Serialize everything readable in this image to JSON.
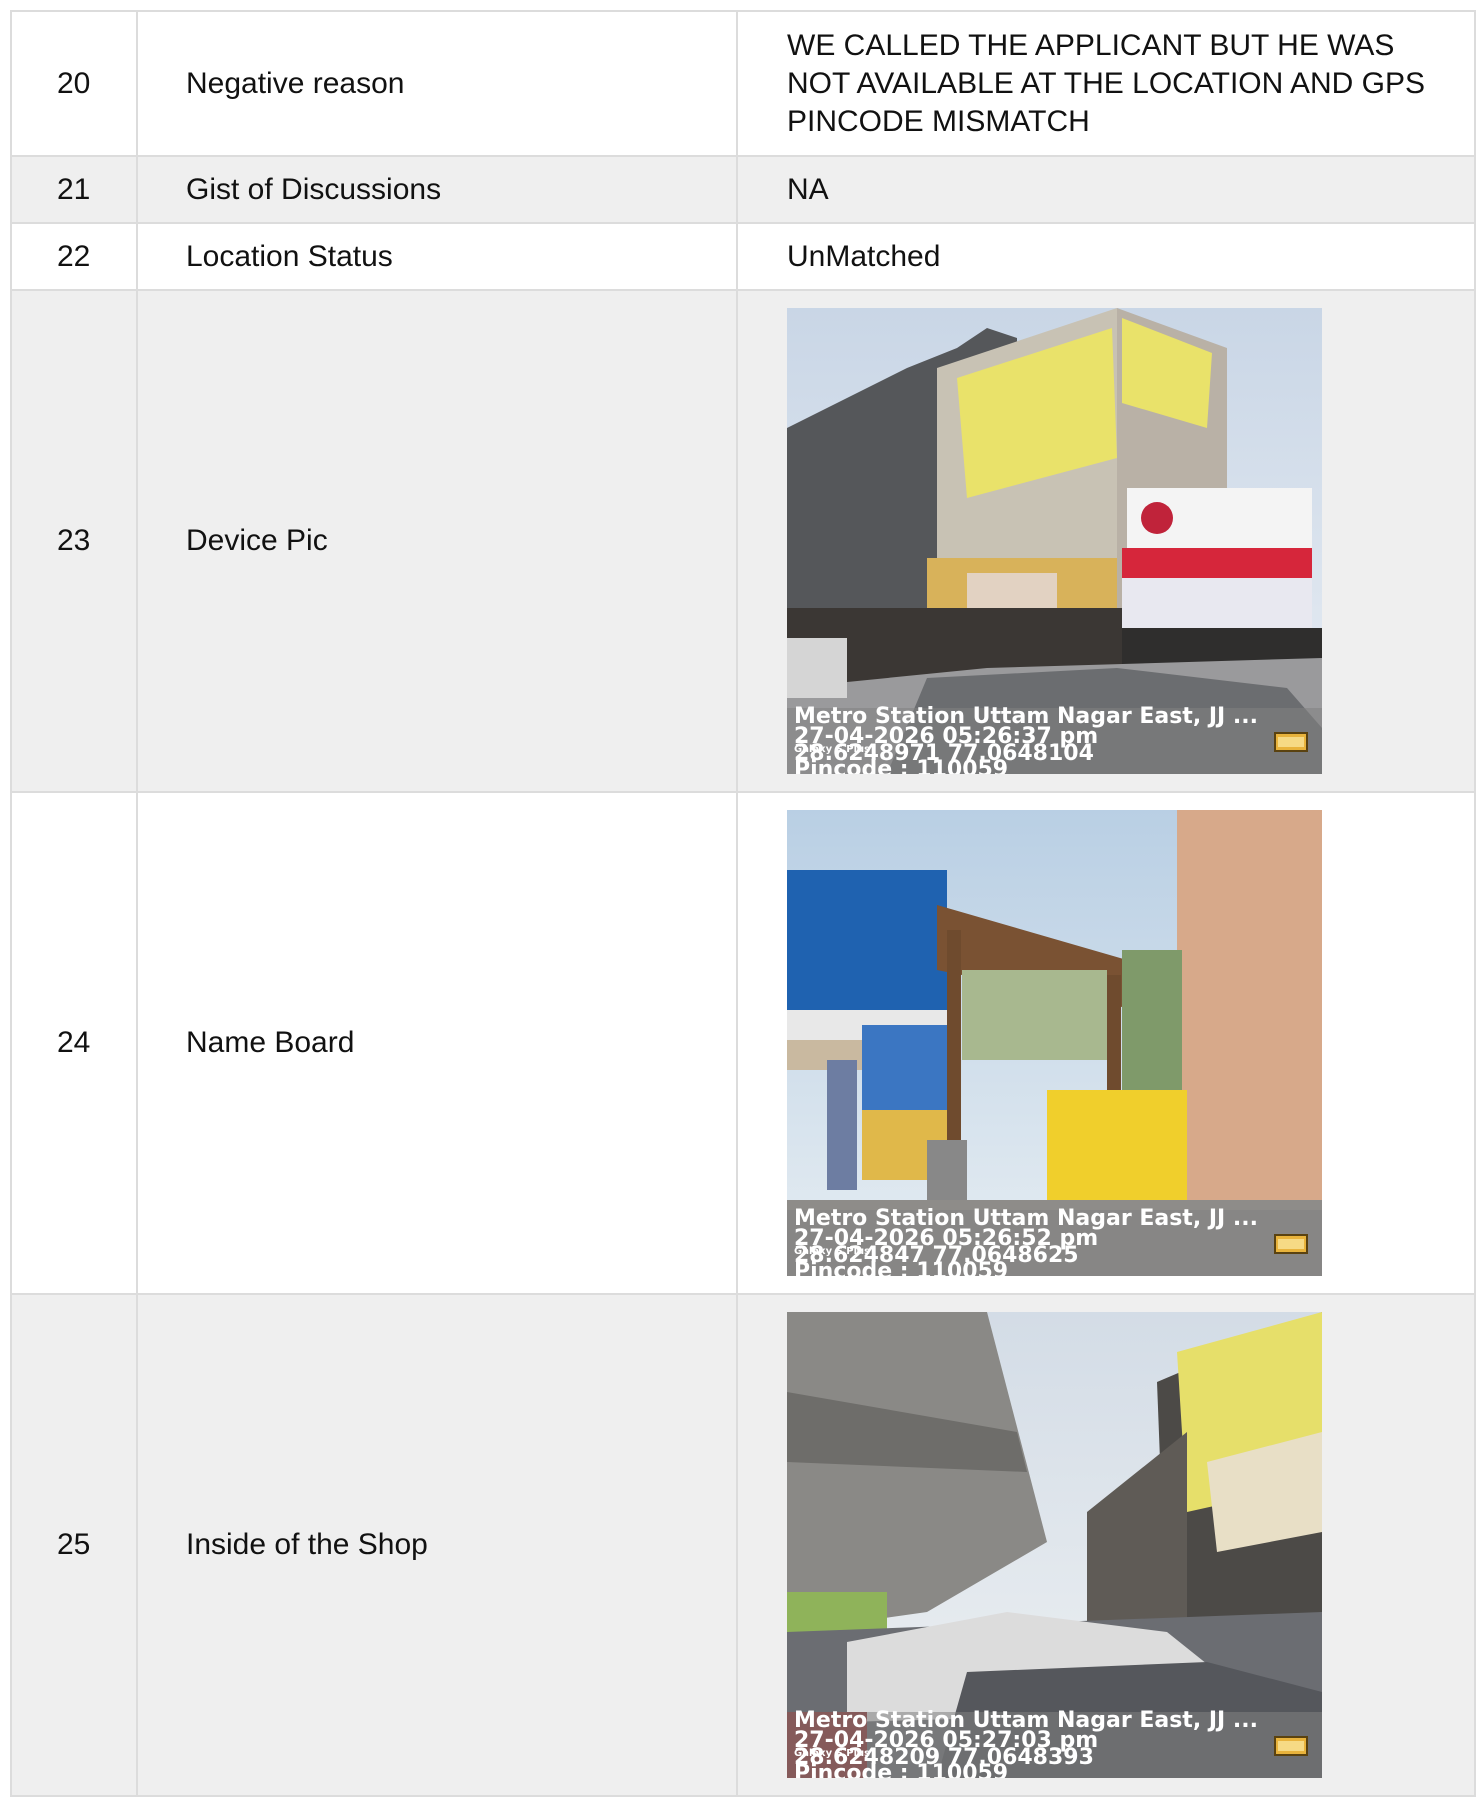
{
  "rows": [
    {
      "num": "20",
      "label": "Negative reason",
      "value": "WE CALLED THE APPLICANT BUT HE WAS NOT AVAILABLE AT THE LOCATION AND GPS PINCODE MISMATCH"
    },
    {
      "num": "21",
      "label": "Gist of Discussions",
      "value": "NA"
    },
    {
      "num": "22",
      "label": "Location Status",
      "value": "UnMatched"
    }
  ],
  "photo_rows": [
    {
      "num": "23",
      "label": "Device Pic",
      "overlay": {
        "address": "Metro Station Uttam Nagar East, JJ ...",
        "datetime": "27-04-2026 05:26:37 pm",
        "small": "Galaxy S Plus",
        "coords": "28.6248971 77.0648104",
        "pincode": "Pincode : 110059"
      }
    },
    {
      "num": "24",
      "label": "Name Board",
      "overlay": {
        "address": "Metro Station Uttam Nagar East, JJ ...",
        "datetime": "27-04-2026 05:26:52 pm",
        "small": "Galaxy S Plus",
        "coords": "28.624847 77.0648625",
        "pincode": "Pincode : 110059"
      }
    },
    {
      "num": "25",
      "label": "Inside of the Shop",
      "overlay": {
        "address": "Metro Station Uttam Nagar East, JJ ...",
        "datetime": "27-04-2026 05:27:03 pm",
        "small": "Galaxy S Plus",
        "coords": "28.6248209 77.0648393",
        "pincode": "Pincode : 110059"
      }
    }
  ],
  "colors": {
    "row_alt": "#efefef",
    "border": "#dcdcdc",
    "stamp": "#e8b33c"
  }
}
